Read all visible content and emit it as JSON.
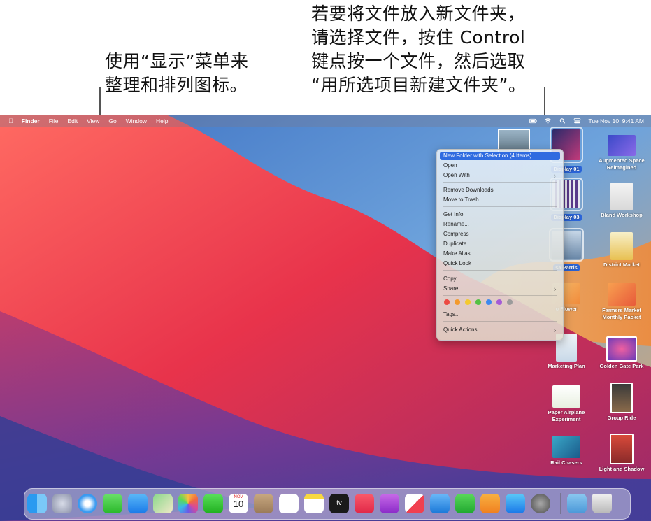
{
  "annotations": {
    "left_callout": [
      "使用“显示”菜单来",
      "整理和排列图标。"
    ],
    "right_callout": [
      "若要将文件放入新文件夹，",
      "请选择文件，按住 Control",
      "键点按一个文件，然后选取",
      "“用所选项目新建文件夹”。"
    ]
  },
  "menubar": {
    "apple": "",
    "app": "Finder",
    "items": [
      "File",
      "Edit",
      "View",
      "Go",
      "Window",
      "Help"
    ],
    "clock": "Tue Nov 10  9:41 AM",
    "status_icons": [
      "battery-icon",
      "wifi-icon",
      "search-icon",
      "control-center-icon"
    ]
  },
  "desktop_items": [
    {
      "label": "Display 01",
      "selected": true
    },
    {
      "label": "Augmented Space Reimagined",
      "selected": false
    },
    {
      "label": "Display 03",
      "selected": true
    },
    {
      "label": "Bland Workshop",
      "selected": false
    },
    {
      "label": "sa Parris",
      "selected": true
    },
    {
      "label": "District Market",
      "selected": false
    },
    {
      "label": "o Flower",
      "selected": false
    },
    {
      "label": "Farmers Market Monthly Packet",
      "selected": false
    },
    {
      "label": "Marketing Plan",
      "selected": false
    },
    {
      "label": "Golden Gate Park",
      "selected": false
    },
    {
      "label": "Paper Airplane Experiment",
      "selected": false
    },
    {
      "label": "Group Ride",
      "selected": false
    },
    {
      "label": "Rail Chasers",
      "selected": false
    },
    {
      "label": "Light and Shadow",
      "selected": false
    }
  ],
  "context_menu": {
    "new_folder": "New Folder with Selection (4 Items)",
    "open": "Open",
    "open_with": "Open With",
    "remove_downloads": "Remove Downloads",
    "move_to_trash": "Move to Trash",
    "get_info": "Get Info",
    "rename": "Rename...",
    "compress": "Compress",
    "duplicate": "Duplicate",
    "make_alias": "Make Alias",
    "quick_look": "Quick Look",
    "copy": "Copy",
    "share": "Share",
    "tags": "Tags...",
    "quick_actions": "Quick Actions",
    "tag_colors": [
      "#ec4b43",
      "#f39a2d",
      "#f4c92f",
      "#53c144",
      "#3d89ef",
      "#a45bd6",
      "#9b9b9b"
    ],
    "submenu_chevron": "›"
  },
  "dock": {
    "calendar_month": "NOV",
    "calendar_day": "10",
    "tv_label": "tv",
    "apps": [
      "finder-icon",
      "launchpad-icon",
      "safari-icon",
      "messages-icon",
      "mail-icon",
      "maps-icon",
      "photos-icon",
      "facetime-icon",
      "calendar-icon",
      "contacts-icon",
      "reminders-icon",
      "notes-icon",
      "appletv-icon",
      "music-icon",
      "podcasts-icon",
      "news-icon",
      "keynote-icon",
      "numbers-icon",
      "pages-icon",
      "appstore-icon",
      "system-preferences-icon",
      "downloads-folder-icon",
      "trash-icon"
    ]
  }
}
